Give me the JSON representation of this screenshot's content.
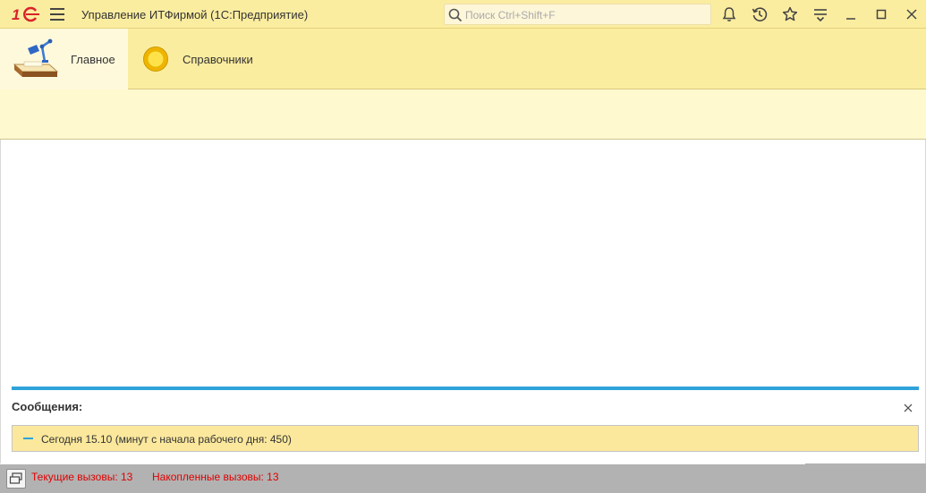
{
  "titlebar": {
    "app_title": "Управление ИТФирмой  (1С:Предприятие)",
    "logo_text": "1С",
    "search_placeholder": "Поиск Ctrl+Shift+F",
    "icons": [
      "bell-icon",
      "history-icon",
      "star-icon",
      "settings-menu-icon",
      "minimize-icon",
      "maximize-icon",
      "close-icon"
    ]
  },
  "sections": [
    {
      "label": "Главное",
      "icon": "desk-lamp-icon",
      "active": true
    },
    {
      "label": "Справочники",
      "icon": "yellow-circle-icon",
      "active": false
    }
  ],
  "messages": {
    "title": "Сообщения:",
    "items": [
      "Сегодня 15.10 (минут с начала рабочего дня: 450)"
    ]
  },
  "statusbar": {
    "current_calls": "Текущие вызовы: 13",
    "accumulated_calls": "Накопленные вызовы: 13"
  },
  "colors": {
    "titlebar_bg": "#fbeda0",
    "panel_bg": "#fff9cf",
    "message_bar": "#2fa3d9",
    "message_row_bg": "#fbe89c",
    "statusbar_bg": "#b2b2b2",
    "status_text": "#e00000",
    "logo_red": "#d8232a"
  }
}
